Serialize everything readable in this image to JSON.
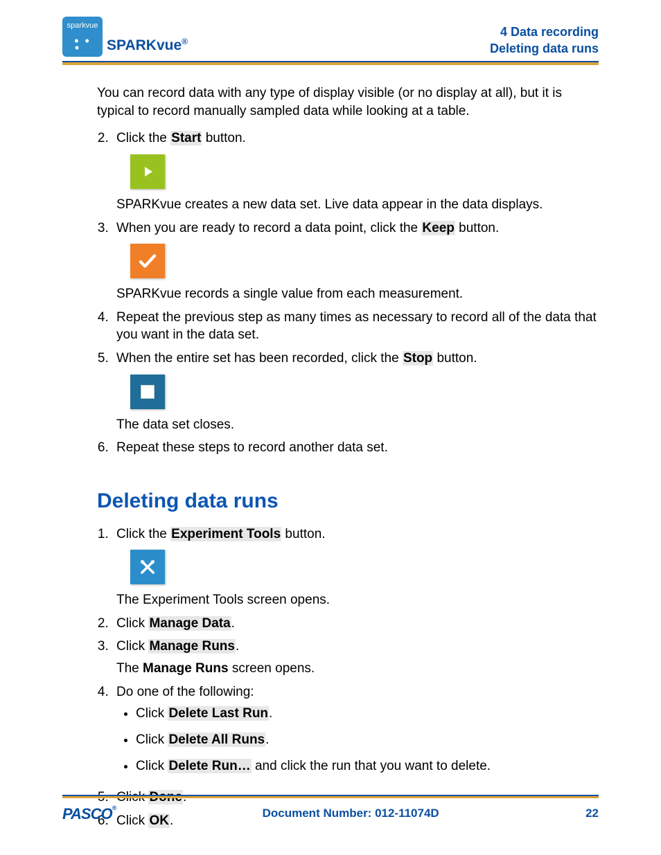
{
  "header": {
    "logo_text": "sparkvue",
    "product": "SPARKvue",
    "reg": "®",
    "chapter_line": "4   Data recording",
    "section_line": "Deleting data runs"
  },
  "intro": "You can record data with any type of display visible (or no display at all), but it is typical to record manually sampled data while looking at a table.",
  "list1": {
    "item2_pre": "Click the ",
    "item2_bold": "Start",
    "item2_post": " button.",
    "item2_after": "SPARKvue creates a new data set. Live data appear in the data displays.",
    "item3_pre": "When you are ready to record a data point, click the ",
    "item3_bold": "Keep",
    "item3_post": " button.",
    "item3_after": "SPARKvue records a single value from each measurement.",
    "item4": "Repeat the previous step as many times as necessary to record all of the data that you want in the data set.",
    "item5_pre": "When the entire set has been recorded, click the ",
    "item5_bold": "Stop",
    "item5_post": " button.",
    "item5_after": "The data set closes.",
    "item6": "Repeat these steps to record another data set."
  },
  "section_heading": "Deleting data runs",
  "list2": {
    "item1_pre": "Click the ",
    "item1_bold": "Experiment Tools",
    "item1_post": " button.",
    "item1_after": "The Experiment Tools screen opens.",
    "item2_pre": "Click ",
    "item2_bold": "Manage Data",
    "item2_post": ".",
    "item3_pre": "Click ",
    "item3_bold": "Manage Runs",
    "item3_post": ".",
    "item3_after_pre": "The ",
    "item3_after_bold": "Manage Runs",
    "item3_after_post": " screen opens.",
    "item4_intro": "Do one of the following:",
    "item4_b1_pre": "Click ",
    "item4_b1_bold": "Delete Last Run",
    "item4_b1_post": ".",
    "item4_b2_pre": "Click ",
    "item4_b2_bold": "Delete All Runs",
    "item4_b2_post": ".",
    "item4_b3_pre": "Click ",
    "item4_b3_bold": "Delete Run…",
    "item4_b3_post": " and click the run that you want to delete.",
    "item5_pre": "Click ",
    "item5_bold": "Done",
    "item5_post": ".",
    "item6_pre": "Click ",
    "item6_bold": "OK",
    "item6_post": "."
  },
  "footer": {
    "brand": "PASCO",
    "docnum": "Document Number: 012-11074D",
    "page": "22"
  }
}
